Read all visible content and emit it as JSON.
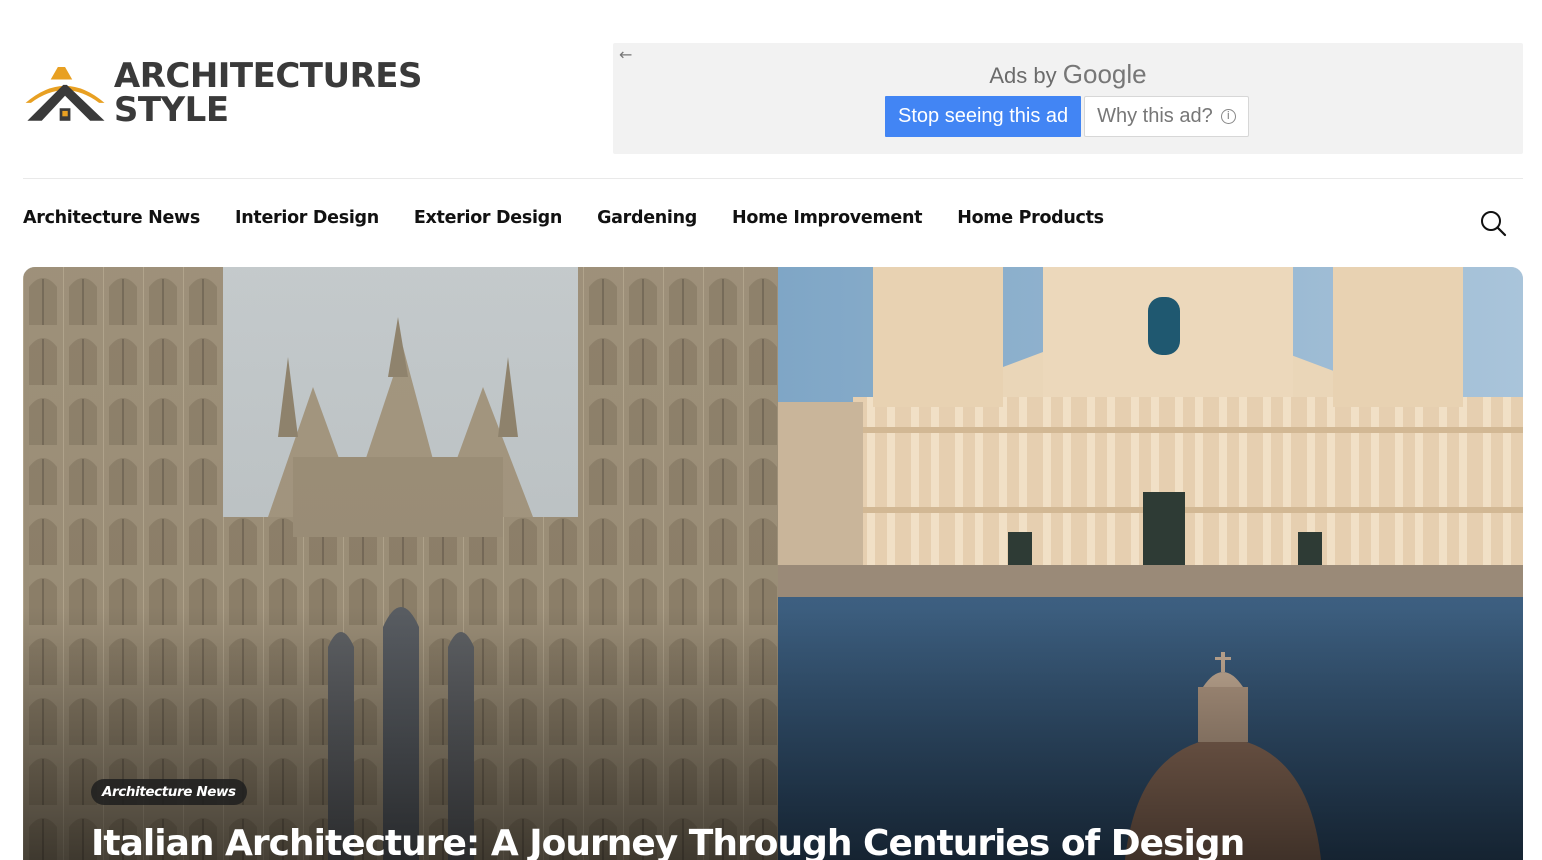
{
  "logo": {
    "line1": "ARCHITECTURES",
    "line2": "STYLE",
    "colors": {
      "accent": "#e8a022",
      "text": "#3a3a3a"
    }
  },
  "ad": {
    "back_icon": "arrow-left-icon",
    "ads_by": "Ads by",
    "google": "Google",
    "stop_label": "Stop seeing this ad",
    "why_label": "Why this ad?",
    "info_icon": "info-icon",
    "colors": {
      "stop_bg": "#4285f4",
      "box_bg": "#f2f2f2"
    }
  },
  "nav": {
    "items": [
      {
        "label": "Architecture News"
      },
      {
        "label": "Interior Design"
      },
      {
        "label": "Exterior Design"
      },
      {
        "label": "Gardening"
      },
      {
        "label": "Home Improvement"
      },
      {
        "label": "Home Products"
      }
    ],
    "search_icon": "search-icon"
  },
  "hero": {
    "category": "Architecture News",
    "title": "Italian Architecture: A Journey Through Centuries of Design"
  }
}
